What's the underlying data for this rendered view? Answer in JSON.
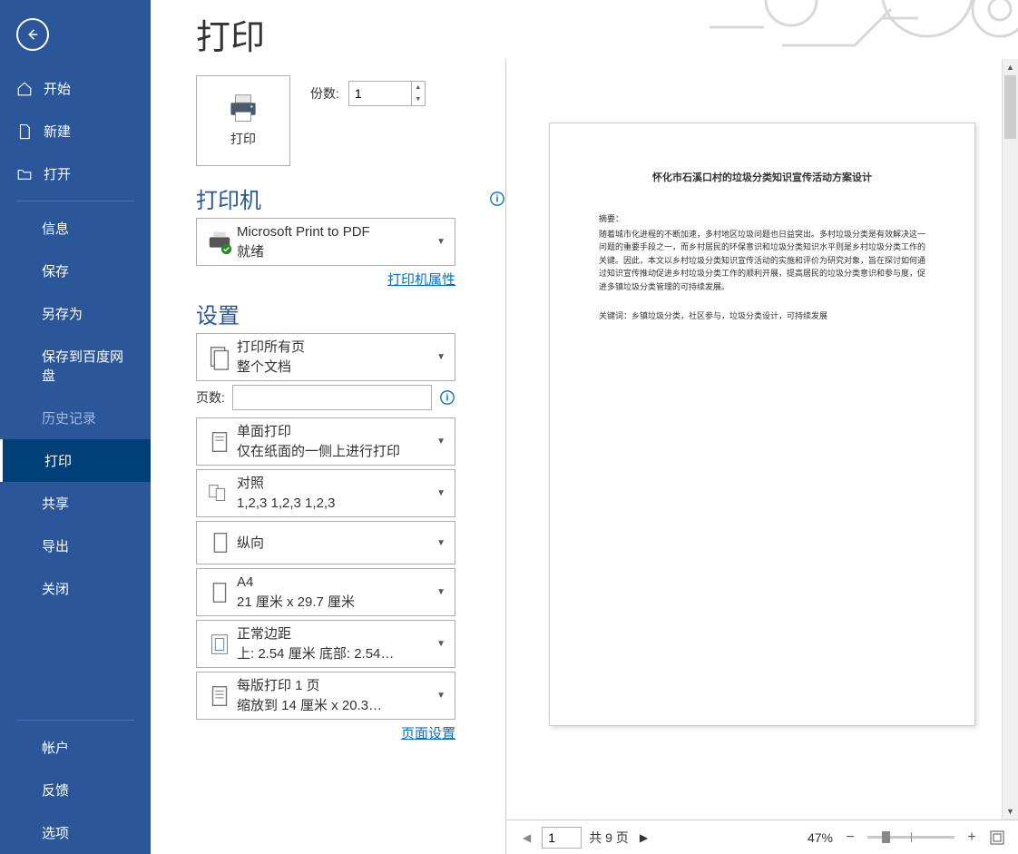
{
  "header": {
    "title": "打印"
  },
  "sidebar": {
    "start": "开始",
    "new": "新建",
    "open": "打开",
    "info": "信息",
    "save": "保存",
    "saveas": "另存为",
    "baidu": "保存到百度网盘",
    "history": "历史记录",
    "print": "打印",
    "share": "共享",
    "export": "导出",
    "close": "关闭",
    "account": "帐户",
    "feedback": "反馈",
    "options": "选项"
  },
  "print": {
    "button_label": "打印",
    "copies_label": "份数:",
    "copies_value": "1"
  },
  "printer": {
    "title": "打印机",
    "name": "Microsoft Print to PDF",
    "status": "就绪",
    "props_link": "打印机属性"
  },
  "settings": {
    "title": "设置",
    "pages_label": "页数:",
    "page_setup_link": "页面设置",
    "items": {
      "range": {
        "line1": "打印所有页",
        "line2": "整个文档"
      },
      "sides": {
        "line1": "单面打印",
        "line2": "仅在纸面的一侧上进行打印"
      },
      "collate": {
        "line1": "对照",
        "line2": "1,2,3    1,2,3    1,2,3"
      },
      "orient": {
        "line1": "纵向",
        "line2": ""
      },
      "paper": {
        "line1": "A4",
        "line2": "21 厘米 x 29.7 厘米"
      },
      "margins": {
        "line1": "正常边距",
        "line2": "上: 2.54 厘米 底部: 2.54…"
      },
      "perpage": {
        "line1": "每版打印 1 页",
        "line2": "缩放到 14 厘米 x 20.3…"
      }
    }
  },
  "preview": {
    "doc_title": "怀化市石溪口村的垃圾分类知识宣传活动方案设计",
    "abstract_head": "摘要：",
    "abstract": "随着城市化进程的不断加速，多村地区垃圾问题也日益突出。多村垃圾分类是有效解决这一问题的重要手段之一，而乡村居民的环保意识和垃圾分类知识水平则是乡村垃圾分类工作的关键。因此，本文以乡村垃圾分类知识宣传活动的实施和评价为研究对象，旨在探讨如何通过知识宣传推动促进乡村垃圾分类工作的顺利开展，提高居民的垃圾分类意识和参与度，促进多镇垃圾分类管理的可持续发展。",
    "keywords": "关键词：乡镇垃圾分类，社区参与，垃圾分类设计，可持续发展"
  },
  "footer": {
    "page": "1",
    "total_label": "共 9 页",
    "zoom": "47%"
  }
}
